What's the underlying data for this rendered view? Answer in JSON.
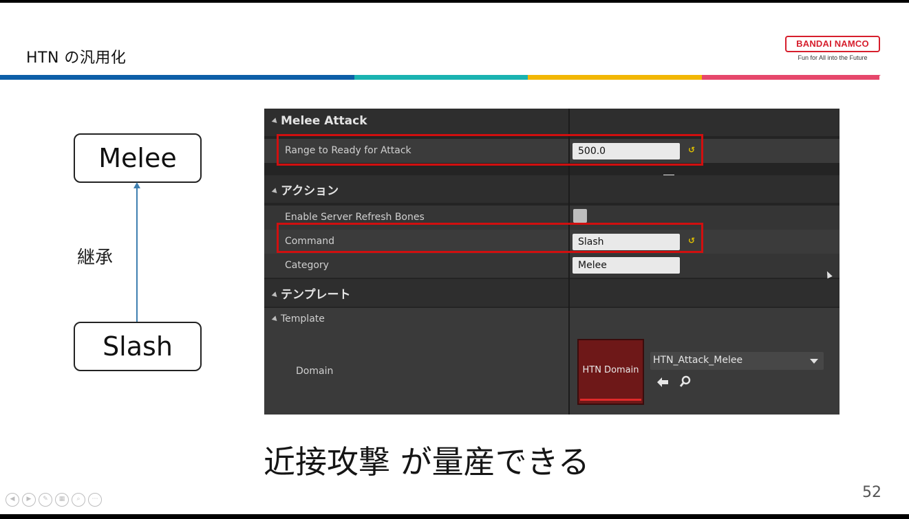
{
  "slide": {
    "title": "HTN の汎用化",
    "logo": {
      "brand": "BANDAI NAMCO",
      "tagline": "Fun for All into the Future"
    },
    "page_number": "52",
    "bottom_text": "近接攻撃 が量産できる"
  },
  "diagram": {
    "parent_node": "Melee",
    "child_node": "Slash",
    "edge_label": "継承"
  },
  "editor": {
    "sections": [
      {
        "label": "Melee Attack"
      },
      {
        "label": "アクション"
      },
      {
        "label": "テンプレート"
      }
    ],
    "properties": {
      "range_label": "Range to Ready for Attack",
      "range_value": "500.0",
      "enable_label": "Enable Server Refresh Bones",
      "command_label": "Command",
      "command_value": "Slash",
      "category_label": "Category",
      "category_value": "Melee",
      "template_label": "Template",
      "domain_label": "Domain",
      "domain_thumb_label": "HTN Domain",
      "domain_value": "HTN_Attack_Melee"
    },
    "reset_glyph": "↺",
    "icons": [
      "slider-icon",
      "reset-icon",
      "checkbox",
      "back-arrow-icon",
      "search-icon",
      "dropdown-caret-icon"
    ]
  },
  "nav_controls": [
    "previous-icon",
    "next-icon",
    "pen-icon",
    "slides-icon",
    "zoom-icon",
    "more-icon"
  ],
  "colors": {
    "highlight": "#d10f0f",
    "stripe_blue": "#0d5fa8",
    "stripe_teal": "#1ab3b1",
    "stripe_yellow": "#f2b705",
    "stripe_pink": "#e6476b",
    "brand_red": "#d61e2c"
  }
}
